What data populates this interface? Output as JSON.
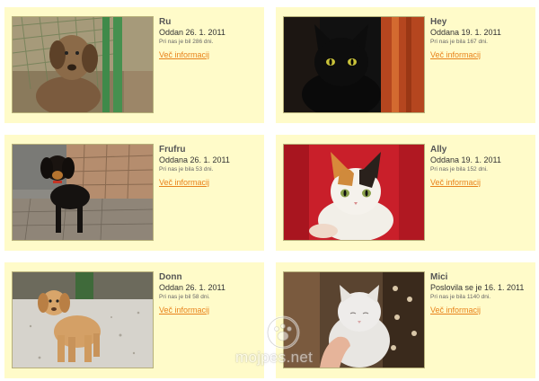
{
  "animals": [
    {
      "name": "Ru",
      "status": "Oddan 26. 1. 2011",
      "stay": "Pri nas je bil 286 dni.",
      "more_label": "Več informacij"
    },
    {
      "name": "Hey",
      "status": "Oddana 19. 1. 2011",
      "stay": "Pri nas je bila 167 dni.",
      "more_label": "Več informacij"
    },
    {
      "name": "Frufru",
      "status": "Oddana 26. 1. 2011",
      "stay": "Pri nas je bila 53 dni.",
      "more_label": "Več informacij"
    },
    {
      "name": "Ally",
      "status": "Oddana 19. 1. 2011",
      "stay": "Pri nas je bila 152 dni.",
      "more_label": "Več informacij"
    },
    {
      "name": "Donn",
      "status": "Oddan 26. 1. 2011",
      "stay": "Pri nas je bil 58 dni.",
      "more_label": "Več informacij"
    },
    {
      "name": "Mici",
      "status": "Poslovila se je 16. 1. 2011",
      "stay": "Pri nas je bila 1140 dni.",
      "more_label": "Več informacij"
    }
  ],
  "watermark": {
    "text": "mojpes.net"
  },
  "colors": {
    "card_background": "#fffbc9",
    "link": "#e8821b"
  }
}
